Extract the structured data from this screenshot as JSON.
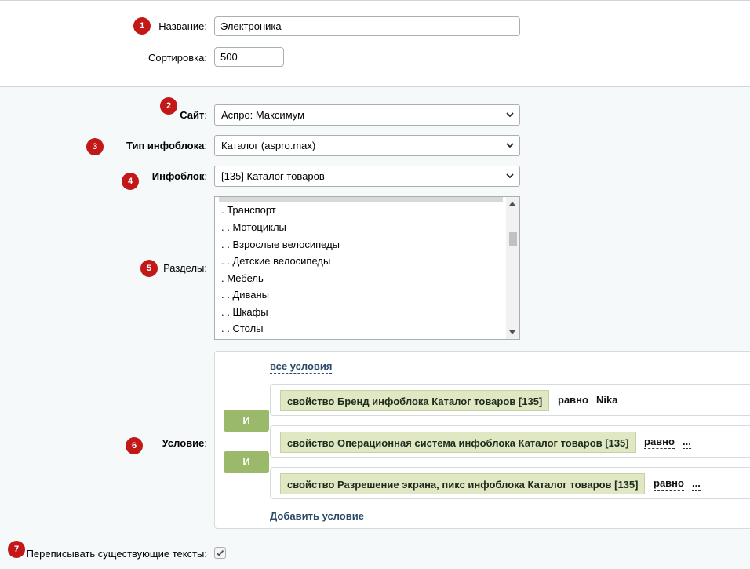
{
  "form": {
    "name_label": "Название",
    "name_value": "Электроника",
    "sort_label": "Сортировка",
    "sort_value": "500",
    "site_label": "Сайт",
    "site_value": "Аспро: Максимум",
    "iblock_type_label": "Тип инфоблока",
    "iblock_type_value": "Каталог (aspro.max)",
    "iblock_label": "Инфоблок",
    "iblock_value": "[135] Каталог товаров",
    "sections_label": "Разделы",
    "sections_options": [
      ". Транспорт",
      ". . Мотоциклы",
      ". . Взрослые велосипеды",
      ". . Детские велосипеды",
      ". Мебель",
      ". . Диваны",
      ". . Шкафы",
      ". . Столы"
    ],
    "condition_label": "Условие",
    "overwrite_label": "Переписывать существующие тексты",
    "overwrite_checked": true
  },
  "condition": {
    "all_conditions_link": "все условия",
    "operator_label": "И",
    "rows": [
      {
        "property": "свойство Бренд инфоблока Каталог товаров [135]",
        "operator": "равно",
        "value": "Nika"
      },
      {
        "property": "свойство Операционная система инфоблока Каталог товаров [135]",
        "operator": "равно",
        "value": "..."
      },
      {
        "property": "свойство Разрешение экрана, пикс инфоблока Каталог товаров [135]",
        "operator": "равно",
        "value": "..."
      }
    ],
    "add_condition_link": "Добавить условие"
  },
  "badges": [
    "1",
    "2",
    "3",
    "4",
    "5",
    "6",
    "7"
  ],
  "colors": {
    "badge": "#c21818",
    "and_button": "#9ab96b",
    "property_bg": "#dfe8c2",
    "link": "#2b4a6b"
  },
  "icons": {
    "select_arrow": "chevron-down-icon",
    "checkbox": "check-icon"
  }
}
